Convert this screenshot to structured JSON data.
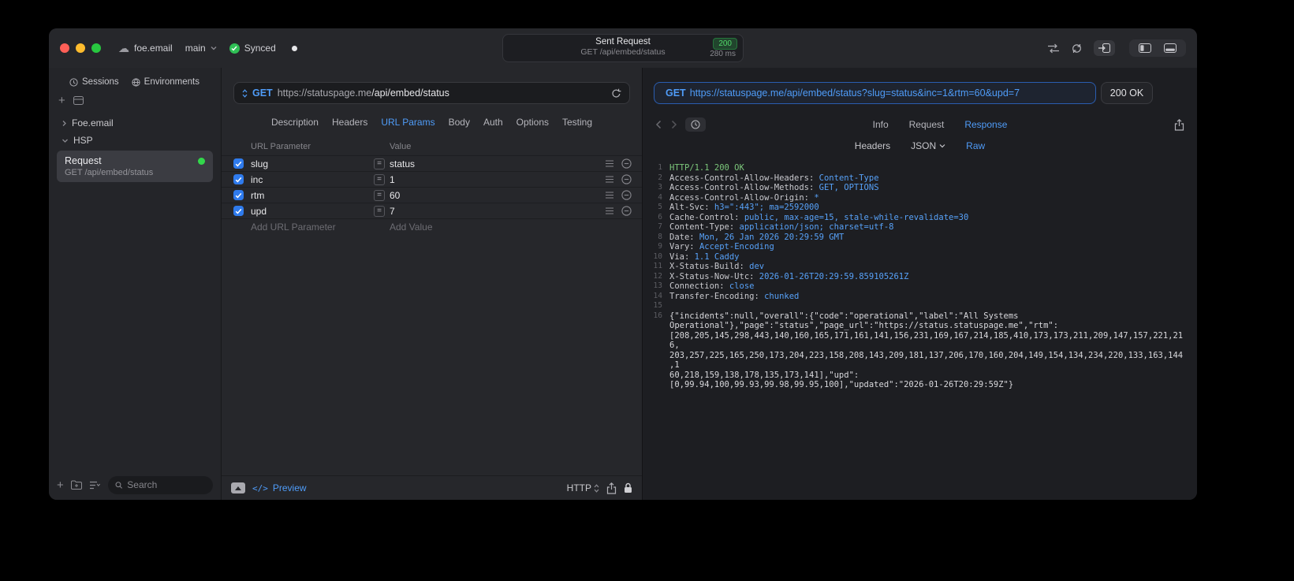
{
  "accents": {
    "blue": "#4f9cf8",
    "green": "#32d74b",
    "badge_green": "#52d96a",
    "value_blue": "#57a1f8",
    "status_green": "#7cc77b"
  },
  "titlebar": {
    "project": "foe.email",
    "branch": "main",
    "sync_label": "Synced",
    "summary": {
      "title": "Sent Request",
      "status_code": "200",
      "method_path": "GET /api/embed/status",
      "duration": "280 ms"
    }
  },
  "sidebar": {
    "tabs": [
      {
        "label": "Sessions"
      },
      {
        "label": "Environments"
      }
    ],
    "tree": [
      {
        "label": "Foe.email"
      },
      {
        "label": "HSP"
      }
    ],
    "request_item": {
      "title": "Request",
      "subtitle": "GET /api/embed/status"
    },
    "search_placeholder": "Search"
  },
  "request": {
    "method": "GET",
    "url_host": "https://statuspage.me",
    "url_path": "/api/embed/status",
    "tabs": [
      "Description",
      "Headers",
      "URL Params",
      "Body",
      "Auth",
      "Options",
      "Testing"
    ],
    "active_tab": "URL Params",
    "params": {
      "columns": [
        "URL Parameter",
        "Value"
      ],
      "rows": [
        {
          "name": "slug",
          "value": "status",
          "enabled": true
        },
        {
          "name": "inc",
          "value": "1",
          "enabled": true
        },
        {
          "name": "rtm",
          "value": "60",
          "enabled": true
        },
        {
          "name": "upd",
          "value": "7",
          "enabled": true
        }
      ],
      "add_name_placeholder": "Add URL Parameter",
      "add_value_placeholder": "Add Value"
    },
    "footer": {
      "preview_label": "Preview",
      "code_glyph": "</>",
      "protocol_label": "HTTP"
    }
  },
  "response": {
    "method": "GET",
    "request_url": "https://statuspage.me/api/embed/status?slug=status&inc=1&rtm=60&upd=7",
    "status": "200 OK",
    "tabs": [
      "Info",
      "Request",
      "Response"
    ],
    "active_tab": "Response",
    "view_tabs": [
      "Headers",
      "JSON",
      "Raw"
    ],
    "active_view": "Raw",
    "status_line": "HTTP/1.1 200 OK",
    "headers": [
      {
        "name": "Access-Control-Allow-Headers",
        "value": "Content-Type"
      },
      {
        "name": "Access-Control-Allow-Methods",
        "value": "GET, OPTIONS"
      },
      {
        "name": "Access-Control-Allow-Origin",
        "value": "*"
      },
      {
        "name": "Alt-Svc",
        "value": "h3=\":443\"; ma=2592000"
      },
      {
        "name": "Cache-Control",
        "value": "public, max-age=15, stale-while-revalidate=30"
      },
      {
        "name": "Content-Type",
        "value": "application/json; charset=utf-8"
      },
      {
        "name": "Date",
        "value": "Mon, 26 Jan 2026 20:29:59 GMT"
      },
      {
        "name": "Vary",
        "value": "Accept-Encoding"
      },
      {
        "name": "Via",
        "value": "1.1 Caddy"
      },
      {
        "name": "X-Status-Build",
        "value": "dev"
      },
      {
        "name": "X-Status-Now-Utc",
        "value": "2026-01-26T20:29:59.859105261Z"
      },
      {
        "name": "Connection",
        "value": "close"
      },
      {
        "name": "Transfer-Encoding",
        "value": "chunked"
      }
    ],
    "body_lines": [
      "{\"incidents\":null,\"overall\":{\"code\":\"operational\",\"label\":\"All Systems",
      "Operational\"},\"page\":\"status\",\"page_url\":\"https://status.statuspage.me\",\"rtm\":",
      "[208,205,145,298,443,140,160,165,171,161,141,156,231,169,167,214,185,410,173,173,211,209,147,157,221,216,",
      "203,257,225,165,250,173,204,223,158,208,143,209,181,137,206,170,160,204,149,154,134,234,220,133,163,144,1",
      "60,218,159,138,178,135,173,141],\"upd\":",
      "[0,99.94,100,99.93,99.98,99.95,100],\"updated\":\"2026-01-26T20:29:59Z\"}"
    ]
  }
}
